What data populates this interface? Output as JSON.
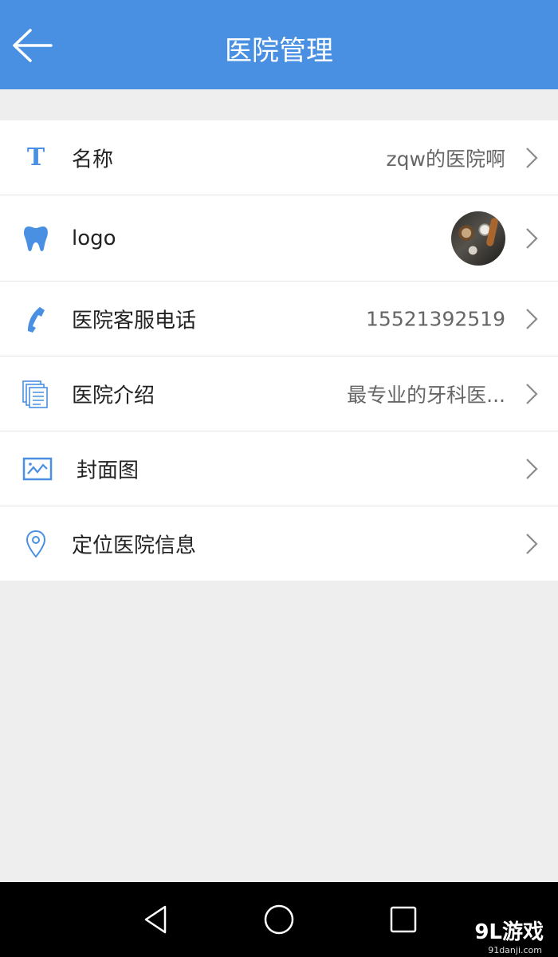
{
  "header": {
    "title": "医院管理"
  },
  "rows": [
    {
      "label": "名称",
      "value": "zqw的医院啊"
    },
    {
      "label": "logo",
      "value": ""
    },
    {
      "label": "医院客服电话",
      "value": "15521392519"
    },
    {
      "label": "医院介绍",
      "value": "最专业的牙科医..."
    },
    {
      "label": "封面图",
      "value": ""
    },
    {
      "label": "定位医院信息",
      "value": ""
    }
  ],
  "watermark": {
    "brand": "9L游戏",
    "url": "91danji.com"
  },
  "colors": {
    "accent": "#4a90e2",
    "background": "#eeeeee",
    "row": "#ffffff",
    "navbar": "#000000"
  },
  "icons": [
    "back-arrow-icon",
    "text-icon",
    "tooth-icon",
    "phone-icon",
    "document-icon",
    "image-icon",
    "location-pin-icon",
    "chevron-right-icon",
    "back-triangle-icon",
    "home-circle-icon",
    "recents-square-icon"
  ]
}
